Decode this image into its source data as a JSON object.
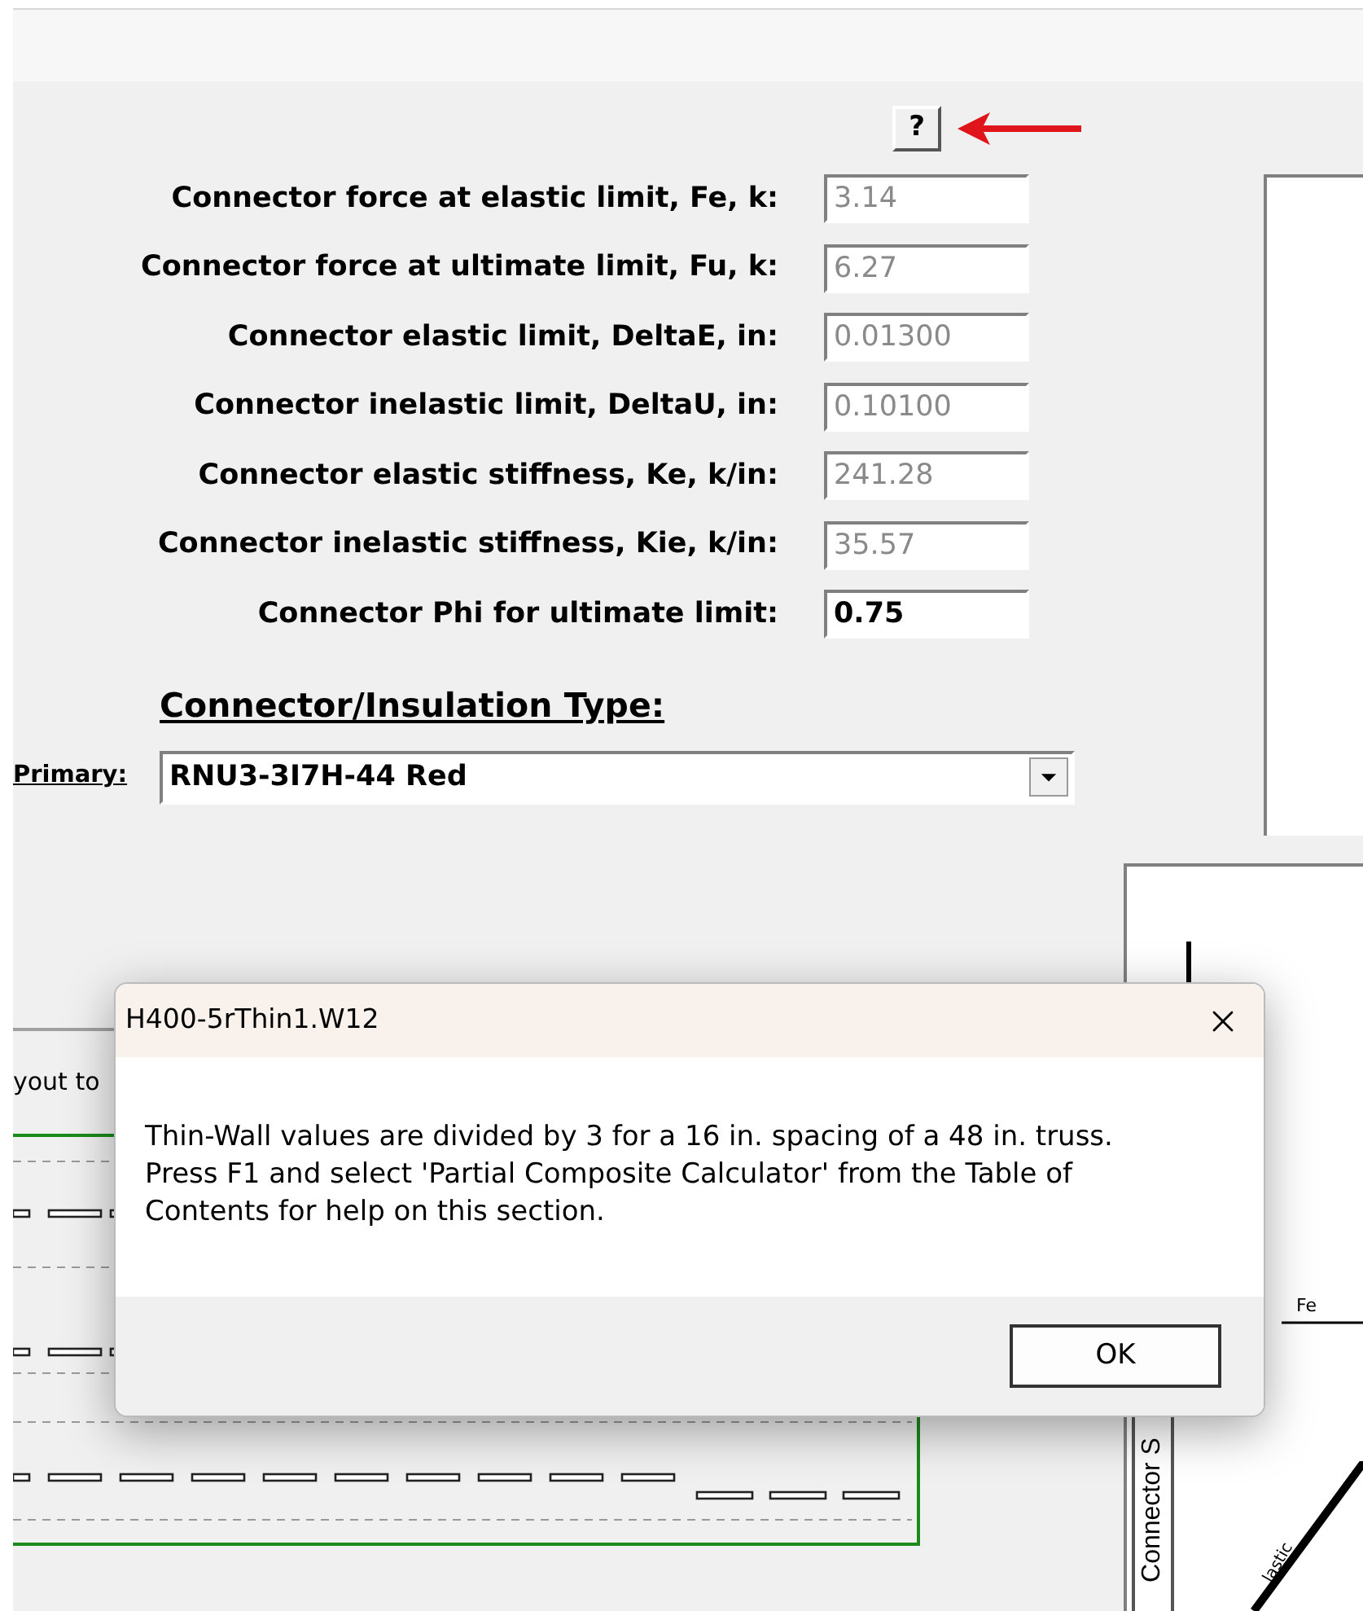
{
  "help_button": {
    "label": "?"
  },
  "fields": [
    {
      "label": "Connector force at elastic limit, Fe, k:",
      "value": "3.14",
      "disabled": true
    },
    {
      "label": "Connector force at ultimate limit, Fu, k:",
      "value": "6.27",
      "disabled": true
    },
    {
      "label": "Connector elastic limit, DeltaE, in:",
      "value": "0.01300",
      "disabled": true
    },
    {
      "label": "Connector inelastic limit, DeltaU, in:",
      "value": "0.10100",
      "disabled": true
    },
    {
      "label": "Connector elastic stiffness, Ke, k/in:",
      "value": "241.28",
      "disabled": true
    },
    {
      "label": "Connector inelastic stiffness, Kie, k/in:",
      "value": "35.57",
      "disabled": true
    },
    {
      "label": "Connector Phi for ultimate limit:",
      "value": "0.75",
      "disabled": false
    }
  ],
  "insulation": {
    "heading": "Connector/Insulation Type:",
    "primary_label": "Primary:",
    "primary_value": "RNU3-3I7H-44 Red"
  },
  "layout_panel": {
    "caption": "yout to"
  },
  "chart": {
    "fe_label": "Fe",
    "axis_label": "Connector S",
    "line_label": "lastic"
  },
  "dialog": {
    "title": "H400-5rThin1.W12",
    "message": "Thin-Wall values are divided by 3 for a 16 in. spacing of a 48 in. truss. Press F1 and select 'Partial Composite Calculator' from the Table of Contents for help on this section.",
    "buttons": [
      "OK"
    ]
  }
}
